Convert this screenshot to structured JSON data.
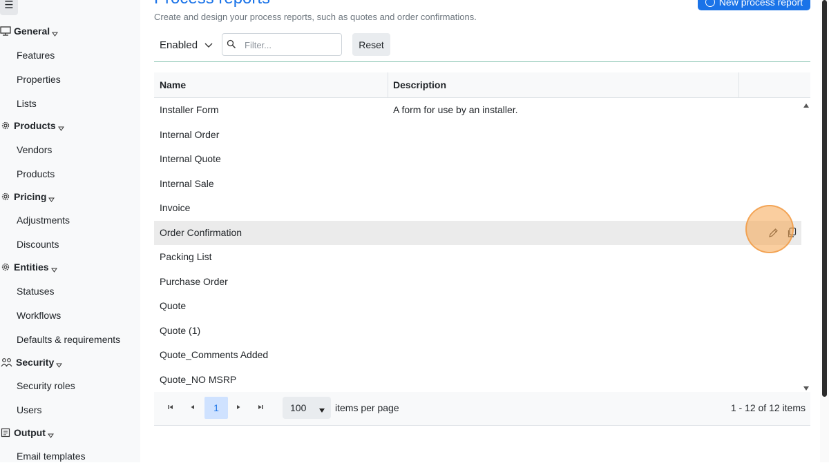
{
  "sidebar": {
    "groups": [
      {
        "label": "General",
        "icon": "monitor-icon",
        "items": [
          "Features",
          "Properties",
          "Lists"
        ]
      },
      {
        "label": "Products",
        "icon": "gear-icon",
        "items": [
          "Vendors",
          "Products"
        ]
      },
      {
        "label": "Pricing",
        "icon": "gear-icon",
        "items": [
          "Adjustments",
          "Discounts"
        ]
      },
      {
        "label": "Entities",
        "icon": "gear-icon",
        "items": [
          "Statuses",
          "Workflows",
          "Defaults & requirements"
        ]
      },
      {
        "label": "Security",
        "icon": "users-icon",
        "items": [
          "Security roles",
          "Users"
        ]
      },
      {
        "label": "Output",
        "icon": "document-icon",
        "items": [
          "Email templates"
        ]
      }
    ]
  },
  "header": {
    "title": "Process reports",
    "subtitle": "Create and design your process reports, such as quotes and order confirmations.",
    "new_button_label": "New process report"
  },
  "toolbar": {
    "status_value": "Enabled",
    "filter_placeholder": "Filter...",
    "reset_label": "Reset"
  },
  "grid": {
    "columns": [
      "Name",
      "Description"
    ],
    "rows": [
      {
        "name": "Installer Form",
        "description": "A form for use by an installer."
      },
      {
        "name": "Internal Order",
        "description": ""
      },
      {
        "name": "Internal Quote",
        "description": ""
      },
      {
        "name": "Internal Sale",
        "description": ""
      },
      {
        "name": "Invoice",
        "description": ""
      },
      {
        "name": "Order Confirmation",
        "description": ""
      },
      {
        "name": "Packing List",
        "description": ""
      },
      {
        "name": "Purchase Order",
        "description": ""
      },
      {
        "name": "Quote",
        "description": ""
      },
      {
        "name": "Quote (1)",
        "description": ""
      },
      {
        "name": "Quote_Comments Added",
        "description": ""
      },
      {
        "name": "Quote_NO MSRP",
        "description": ""
      }
    ],
    "hovered_row_index": 5,
    "row_action_icons": [
      "pencil-icon",
      "copy-icon"
    ]
  },
  "pager": {
    "current_page": "1",
    "page_size": "100",
    "items_per_page_label": "items per page",
    "count_label": "1 - 12 of 12 items"
  },
  "colors": {
    "accent": "#1a73e8",
    "sidebar_bg": "#f8f9fa",
    "hover_row": "#ebebeb",
    "cursor_highlight": "#f5a650"
  }
}
